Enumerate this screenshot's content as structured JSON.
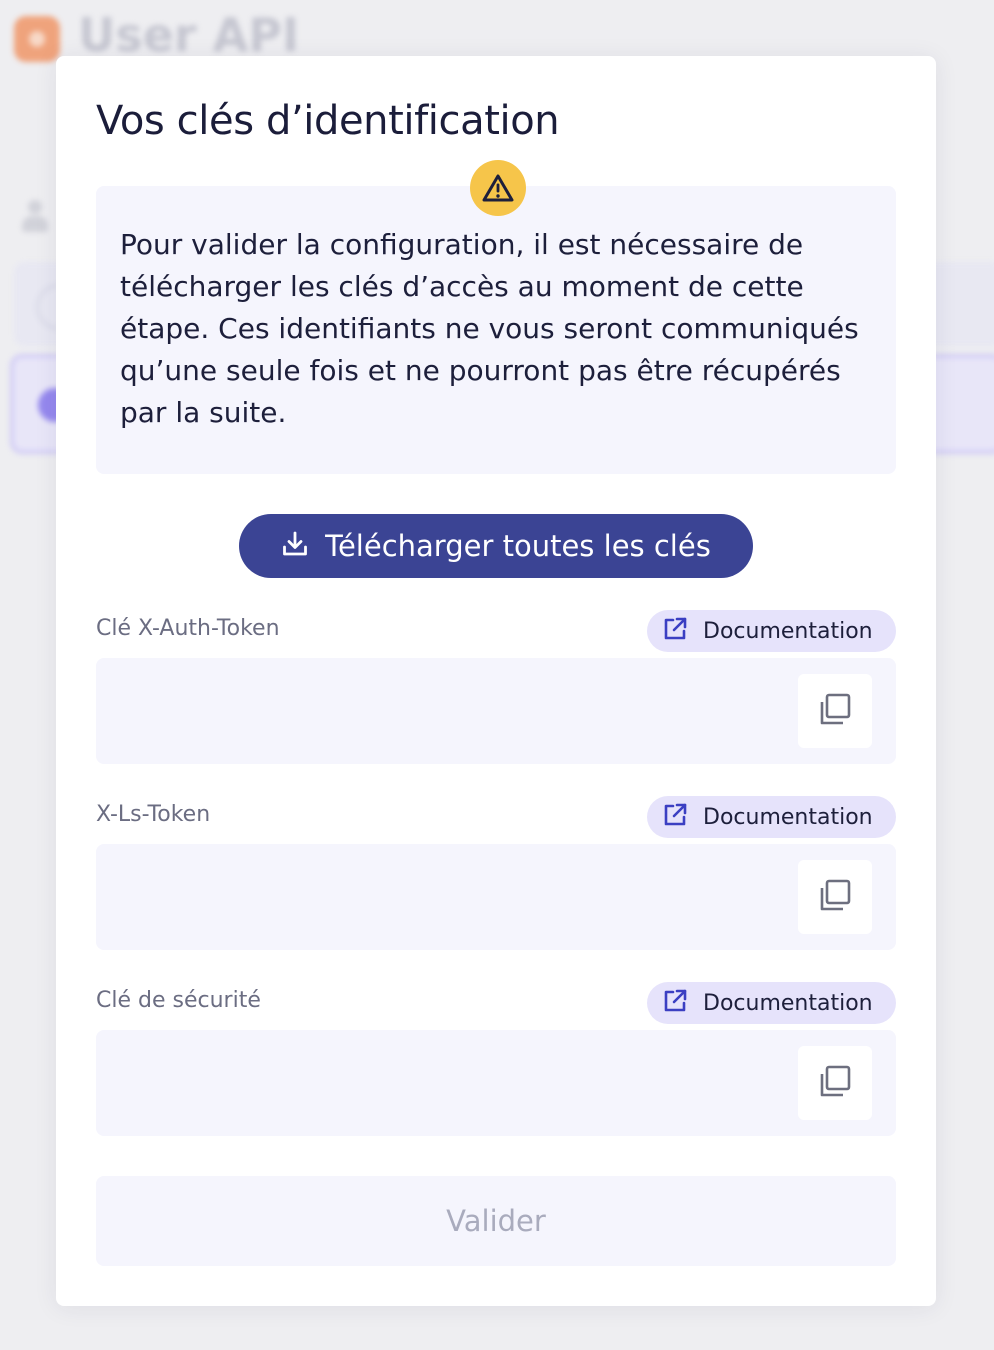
{
  "background": {
    "app_title": "User API",
    "subtitle": "",
    "right_text": ""
  },
  "modal": {
    "title": "Vos clés d’identification",
    "notice_text": "Pour valider la configuration, il est nécessaire de télécharger les clés d’accès au moment de cette étape. Ces identifiants ne vous seront communiqués qu’une seule fois et ne pourront pas être récupérés par la suite.",
    "notice_icon": "warning-icon",
    "download_label": "Télécharger toutes les clés",
    "download_icon": "download-icon",
    "fields": [
      {
        "label": "Clé X-Auth-Token",
        "doc_label": "Documentation",
        "value": ""
      },
      {
        "label": "X-Ls-Token",
        "doc_label": "Documentation",
        "value": ""
      },
      {
        "label": "Clé de sécurité",
        "doc_label": "Documentation",
        "value": ""
      }
    ],
    "validate_label": "Valider",
    "validate_disabled": true
  },
  "colors": {
    "primary": "#3b4494",
    "warning": "#f6c54a",
    "surface": "#f5f5fd",
    "pill": "#e6e3fb",
    "doc_icon": "#3b3fc2",
    "disabled_text": "#a9abbd"
  }
}
